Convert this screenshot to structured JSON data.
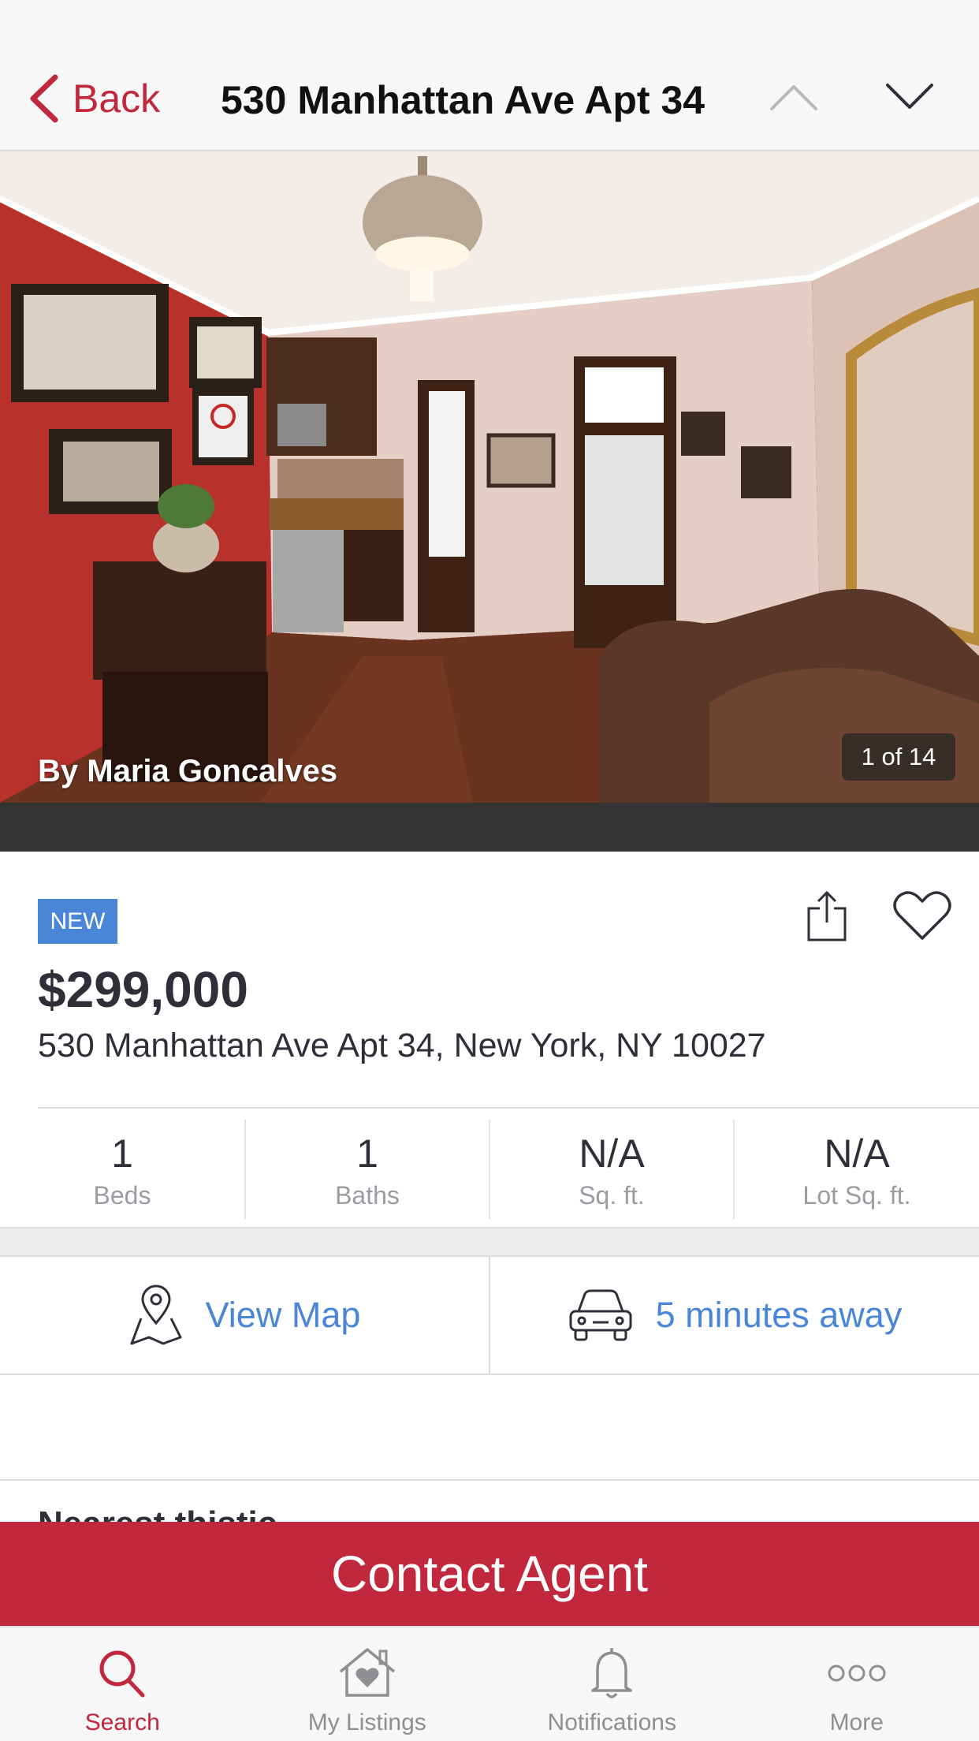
{
  "header": {
    "back_label": "Back",
    "title": "530 Manhattan Ave Apt 34",
    "prev_icon": "chevron-up-icon",
    "next_icon": "chevron-down-icon"
  },
  "photo": {
    "credit": "By Maria Goncalves",
    "counter": "1 of 14"
  },
  "listing": {
    "badge": "NEW",
    "price": "$299,000",
    "address": "530 Manhattan Ave Apt 34, New York, NY 10027",
    "stats": [
      {
        "value": "1",
        "label": "Beds"
      },
      {
        "value": "1",
        "label": "Baths"
      },
      {
        "value": "N/A",
        "label": "Sq. ft."
      },
      {
        "value": "N/A",
        "label": "Lot Sq. ft."
      }
    ]
  },
  "actions": {
    "map_label": "View Map",
    "drive_label": "5 minutes away"
  },
  "peek_heading": "Nearest thistic",
  "contact_label": "Contact Agent",
  "tabs": [
    {
      "label": "Search",
      "icon": "search-icon",
      "active": true
    },
    {
      "label": "My Listings",
      "icon": "house-heart-icon",
      "active": false
    },
    {
      "label": "Notifications",
      "icon": "bell-icon",
      "active": false
    },
    {
      "label": "More",
      "icon": "more-icon",
      "active": false
    }
  ],
  "colors": {
    "accent": "#c1283e",
    "link": "#4a86d8",
    "badge": "#4a86d8"
  }
}
